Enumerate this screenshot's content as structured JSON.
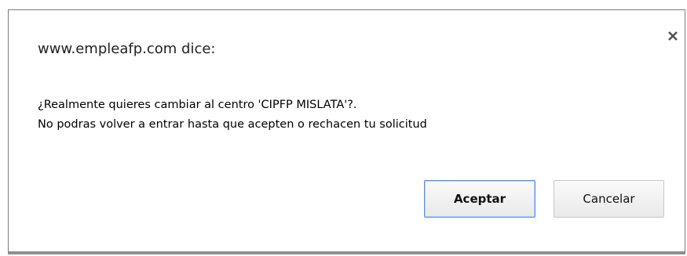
{
  "dialog": {
    "title": "www.empleafp.com dice:",
    "close_icon": "close-icon",
    "message_line1": "¿Realmente quieres cambiar al centro  'CIPFP MISLATA'?.",
    "message_line2": "No podras volver a entrar hasta que acepten o rechacen tu solicitud",
    "accept_label": "Aceptar",
    "cancel_label": "Cancelar"
  },
  "colors": {
    "accept_border": "#4d90fe",
    "button_border": "#c6c6c6",
    "dialog_border": "#7d7d7d"
  }
}
